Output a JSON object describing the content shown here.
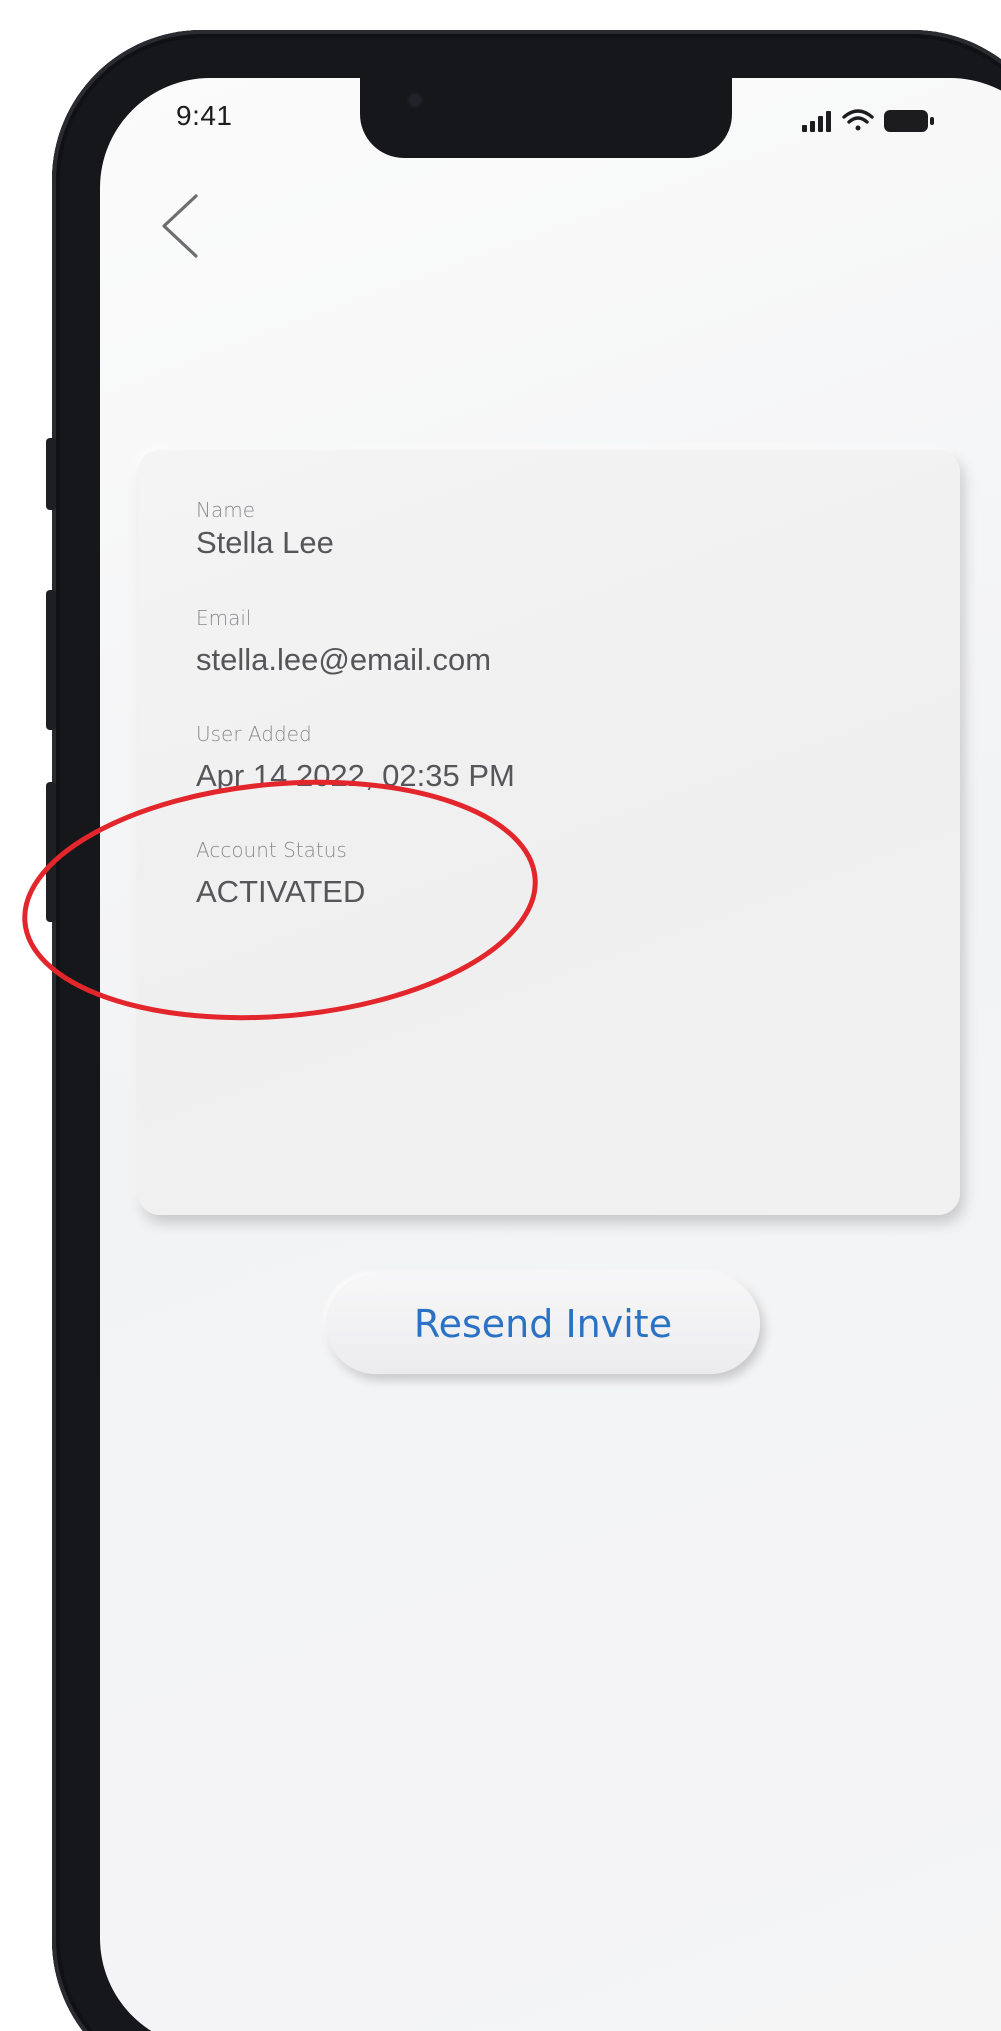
{
  "status_bar": {
    "time": "9:41"
  },
  "navigation": {
    "back_icon": "chevron-left-icon"
  },
  "details": {
    "name_label": "Name",
    "name_value": "Stella Lee",
    "email_label": "Email",
    "email_value": "stella.lee@email.com",
    "added_label": "User Added",
    "added_value": "Apr 14 2022, 02:35 PM",
    "status_label": "Account Status",
    "status_value": "ACTIVATED"
  },
  "actions": {
    "resend_label": "Resend Invite"
  },
  "colors": {
    "accent": "#2b72c5",
    "annotation": "#e3262b"
  }
}
